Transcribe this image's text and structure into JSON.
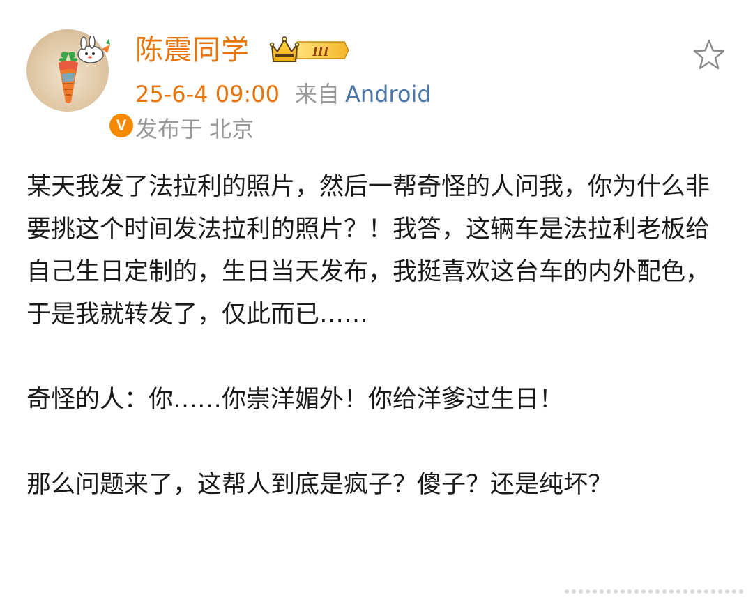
{
  "user": {
    "name": "陈震同学",
    "rank_label": "III",
    "verified_label": "V"
  },
  "post_meta": {
    "time": "25-6-4 09:00",
    "from_label": "来自",
    "client": "Android",
    "location": "发布于 北京"
  },
  "post": {
    "paragraph_1": "某天我发了法拉利的照片，然后一帮奇怪的人问我，你为什么非要挑这个时间发法拉利的照片？！我答，这辆车是法拉利老板给自己生日定制的，生日当天发布，我挺喜欢这台车的内外配色，于是我就转发了，仅此而已……",
    "paragraph_2": "奇怪的人：你……你崇洋媚外！你给洋爹过生日！",
    "paragraph_3": "那么问题来了，这帮人到底是疯子？傻子？还是纯坏？"
  },
  "icons": {
    "favorite": "star-outline-icon",
    "verified": "verified-v-icon",
    "rank": "crown-rank-icon"
  },
  "colors": {
    "accent_orange": "#e8740a",
    "link_blue": "#4a76a8",
    "muted_gray": "#999999",
    "text": "#1a1a1a"
  }
}
